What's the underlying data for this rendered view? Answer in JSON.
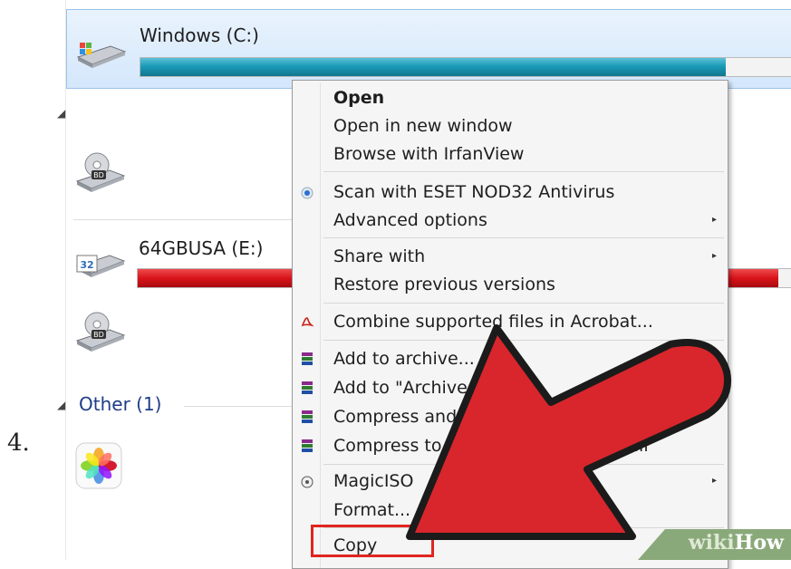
{
  "step_number": "4.",
  "explorer": {
    "drives": [
      {
        "label": "Windows (C:)",
        "fill_fraction": 0.9,
        "bar_color": "#1a9bb8",
        "selected": true,
        "icon": "hard-drive-windows-icon"
      },
      {
        "label": "",
        "icon": "bd-drive-icon"
      },
      {
        "label": "64GBUSA (E:)",
        "fill_fraction": 0.98,
        "bar_color": "#d9141a",
        "icon": "usb-drive-icon"
      },
      {
        "label": "",
        "icon": "bd-drive-icon"
      }
    ],
    "other_group": {
      "label": "Other (1)",
      "icon": "photos-app-icon"
    }
  },
  "context_menu": {
    "items": [
      {
        "label": "Open",
        "bold": true
      },
      {
        "label": "Open in new window"
      },
      {
        "label": "Browse with IrfanView"
      },
      {
        "label": "Scan with ESET NOD32 Antivirus",
        "icon": "eset-icon"
      },
      {
        "label": "Advanced options",
        "submenu": true
      },
      {
        "label": "Share with",
        "submenu": true
      },
      {
        "label": "Restore previous versions"
      },
      {
        "label": "Combine supported files in Acrobat...",
        "icon": "acrobat-icon"
      },
      {
        "label": "Add to archive...",
        "icon": "winrar-icon"
      },
      {
        "label": "Add to \"Archive.rar\"",
        "icon": "winrar-icon"
      },
      {
        "label": "Compress and email...",
        "icon": "winrar-icon"
      },
      {
        "label": "Compress to \"Archive.rar\" and email",
        "icon": "winrar-icon"
      },
      {
        "label": "MagicISO",
        "icon": "magiciso-icon",
        "submenu": true
      },
      {
        "label": "Format..."
      },
      {
        "label": "Copy",
        "highlighted": true
      }
    ]
  },
  "watermark": {
    "part1": "wiki",
    "part2": "How"
  },
  "colors": {
    "highlight": "#e0261f",
    "arrow": "#d8262c",
    "selection_bg": "#d4e7fb"
  }
}
